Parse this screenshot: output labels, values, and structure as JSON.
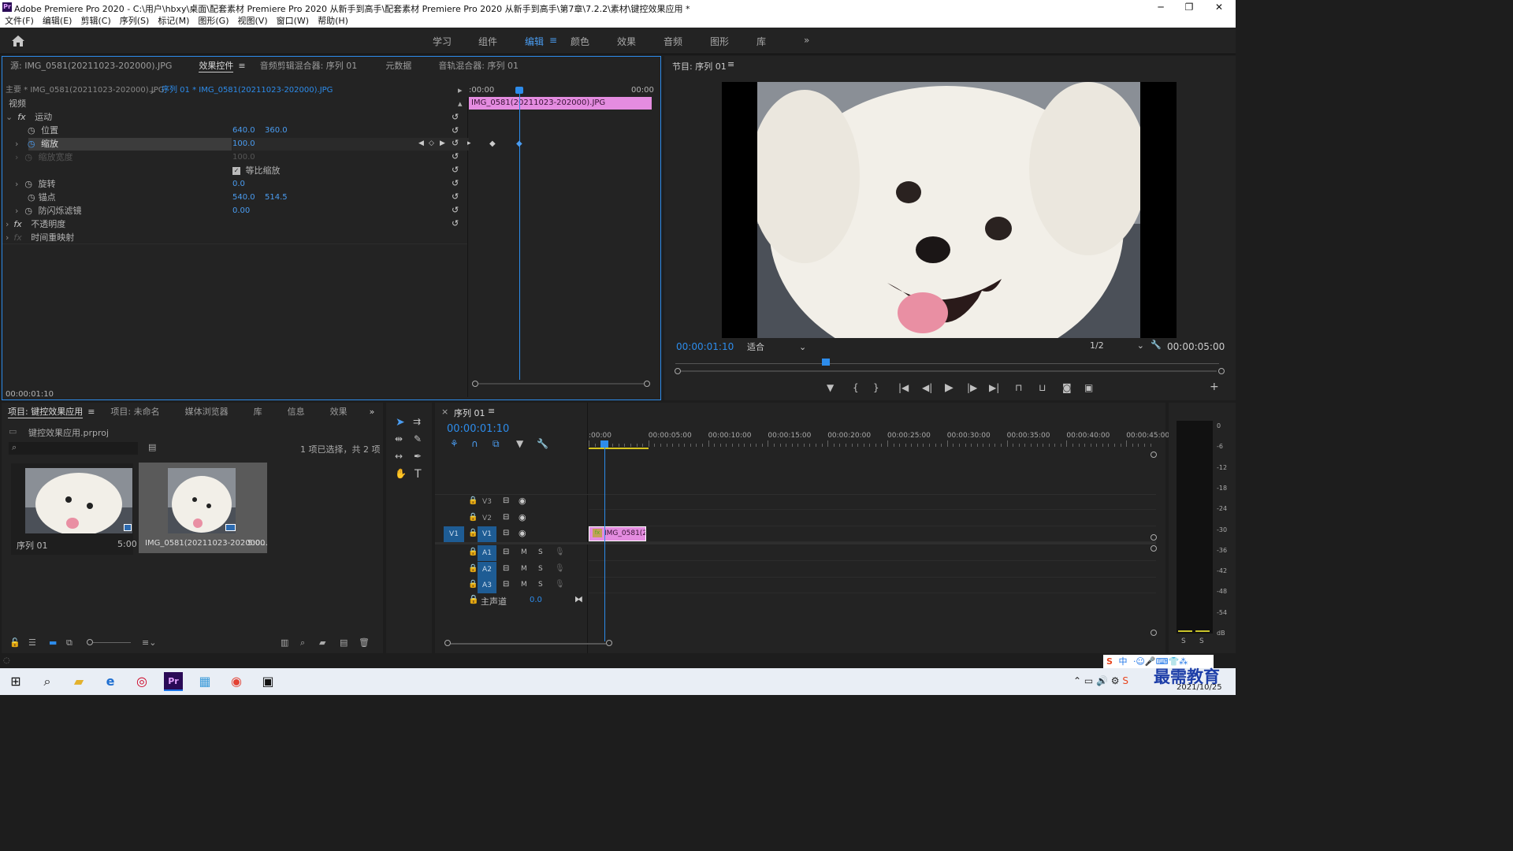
{
  "titlebar": {
    "title": "Adobe Premiere Pro 2020 - C:\\用户\\hbxy\\桌面\\配套素材 Premiere Pro 2020 从新手到高手\\配套素材 Premiere Pro 2020 从新手到高手\\第7章\\7.2.2\\素材\\键控效果应用 *"
  },
  "menu": [
    "文件(F)",
    "编辑(E)",
    "剪辑(C)",
    "序列(S)",
    "标记(M)",
    "图形(G)",
    "视图(V)",
    "窗口(W)",
    "帮助(H)"
  ],
  "workspaces": [
    "学习",
    "组件",
    "编辑",
    "颜色",
    "效果",
    "音频",
    "图形",
    "库"
  ],
  "source_panel": {
    "tabs": [
      "源: IMG_0581(20211023-202000).JPG",
      "效果控件",
      "音频剪辑混合器: 序列 01",
      "元数据",
      "音轨混合器: 序列 01"
    ],
    "master_label": "主要 * IMG_0581(20211023-202000).JPG",
    "seq_label": "序列 01 * IMG_0581(20211023-202000).JPG",
    "time_start": ":00:00",
    "time_end": "00:00",
    "clip_name": "IMG_0581(20211023-202000).JPG",
    "section": "视频",
    "effects": {
      "motion": "运动",
      "position": {
        "label": "位置",
        "x": "640.0",
        "y": "360.0"
      },
      "scale": {
        "label": "缩放",
        "value": "100.0"
      },
      "scale_width": {
        "label": "缩放宽度",
        "value": "100.0"
      },
      "uniform": "等比缩放",
      "rotation": {
        "label": "旋转",
        "value": "0.0"
      },
      "anchor": {
        "label": "锚点",
        "x": "540.0",
        "y": "514.5"
      },
      "flicker": {
        "label": "防闪烁滤镜",
        "value": "0.00"
      },
      "opacity": "不透明度",
      "remap": "时间重映射"
    },
    "timecode": "00:00:01:10"
  },
  "program": {
    "title": "节目: 序列 01",
    "timecode": "00:00:01:10",
    "fit": "适合",
    "resolution": "1/2",
    "duration": "00:00:05:00"
  },
  "project": {
    "tabs": [
      "项目: 键控效果应用",
      "项目: 未命名",
      "媒体浏览器",
      "库",
      "信息",
      "效果"
    ],
    "file": "键控效果应用.prproj",
    "selection": "1 项已选择，共 2 项",
    "items": [
      {
        "name": "序列 01",
        "dur": "5:00"
      },
      {
        "name": "IMG_0581(20211023-202000...",
        "dur": "5:00"
      }
    ]
  },
  "timeline": {
    "title": "序列 01",
    "timecode": "00:00:01:10",
    "ruler": [
      ":00:00",
      "00:00:05:00",
      "00:00:10:00",
      "00:00:15:00",
      "00:00:20:00",
      "00:00:25:00",
      "00:00:30:00",
      "00:00:35:00",
      "00:00:40:00",
      "00:00:45:00"
    ],
    "tracks": [
      "V3",
      "V2",
      "V1",
      "A1",
      "A2",
      "A3"
    ],
    "src_track": "V1",
    "master": "主声道",
    "master_val": "0.0",
    "clip": "IMG_0581(20",
    "m": "M",
    "s": "S"
  },
  "meter": {
    "scale": [
      "0",
      "-6",
      "-12",
      "-18",
      "-24",
      "-30",
      "-36",
      "-42",
      "-48",
      "-54",
      "dB"
    ],
    "s": "S"
  },
  "tray": {
    "date": "2021/10/25",
    "watermark": "最需教育",
    "ime": "中"
  }
}
